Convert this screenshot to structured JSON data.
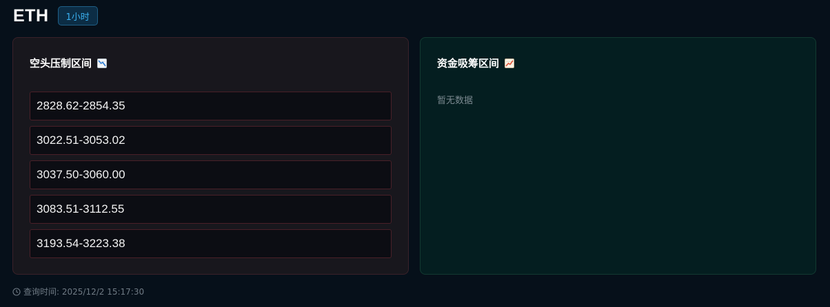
{
  "header": {
    "symbol": "ETH",
    "timeframe": "1小时"
  },
  "bear_panel": {
    "title": "空头压制区间",
    "icon": "chart-decreasing-icon",
    "ranges": [
      "2828.62-2854.35",
      "3022.51-3053.02",
      "3037.50-3060.00",
      "3083.51-3112.55",
      "3193.54-3223.38"
    ]
  },
  "bull_panel": {
    "title": "资金吸筹区间",
    "icon": "chart-increasing-icon",
    "empty_text": "暂无数据"
  },
  "footer": {
    "icon": "clock-icon",
    "query_time": "查询时间: 2025/12/2 15:17:30"
  },
  "colors": {
    "background": "#06101a",
    "bear_panel_bg": "#18171d",
    "bear_border": "#4a2028",
    "bull_panel_bg": "#041e20",
    "badge_text": "#3ab0f0"
  }
}
